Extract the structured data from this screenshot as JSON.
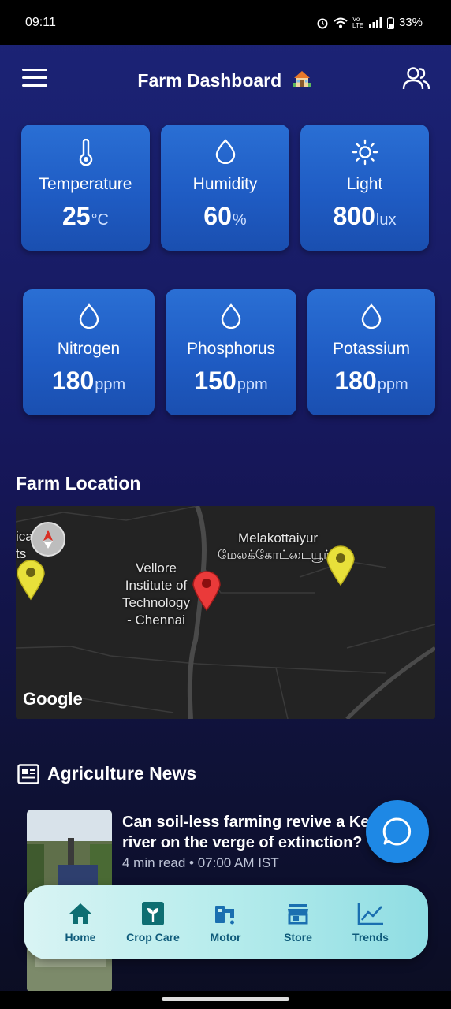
{
  "status_bar": {
    "time": "09:11",
    "battery": "33%",
    "network": "Vo LTE"
  },
  "header": {
    "title": "Farm Dashboard",
    "menu_icon": "menu-icon",
    "profile_icon": "users-icon"
  },
  "sensors": [
    {
      "label": "Temperature",
      "value": "25",
      "unit": "°C",
      "icon": "thermometer-icon"
    },
    {
      "label": "Humidity",
      "value": "60",
      "unit": "%",
      "icon": "drop-icon"
    },
    {
      "label": "Light",
      "value": "800",
      "unit": "lux",
      "icon": "sun-icon"
    }
  ],
  "nutrients": [
    {
      "label": "Nitrogen",
      "value": "180",
      "unit": "ppm",
      "icon": "drop-icon"
    },
    {
      "label": "Phosphorus",
      "value": "150",
      "unit": "ppm",
      "icon": "drop-icon"
    },
    {
      "label": "Potassium",
      "value": "180",
      "unit": "ppm",
      "icon": "drop-icon"
    }
  ],
  "farm_location": {
    "title": "Farm Location",
    "labels": {
      "left": "ical\nts",
      "institute": "Vellore\nInstitute of\nTechnology\n- Chennai",
      "village": "Melakottaiyur",
      "village_tamil": "மேலக்கோட்டையூர்"
    },
    "attribution": "Google"
  },
  "news": {
    "title": "Agriculture News",
    "items": [
      {
        "headline": "Can soil-less farming revive a Kerala river on the verge of extinction?",
        "meta": "4 min read • 07:00 AM IST"
      }
    ]
  },
  "bottom_nav": [
    {
      "label": "Home",
      "icon": "home-icon"
    },
    {
      "label": "Crop Care",
      "icon": "crop-care-icon"
    },
    {
      "label": "Motor",
      "icon": "motor-icon"
    },
    {
      "label": "Store",
      "icon": "store-icon"
    },
    {
      "label": "Trends",
      "icon": "trends-icon"
    }
  ],
  "colors": {
    "card": "#1f5cc4",
    "fab": "#1e88e5",
    "nav_text": "#0e5a7a"
  }
}
